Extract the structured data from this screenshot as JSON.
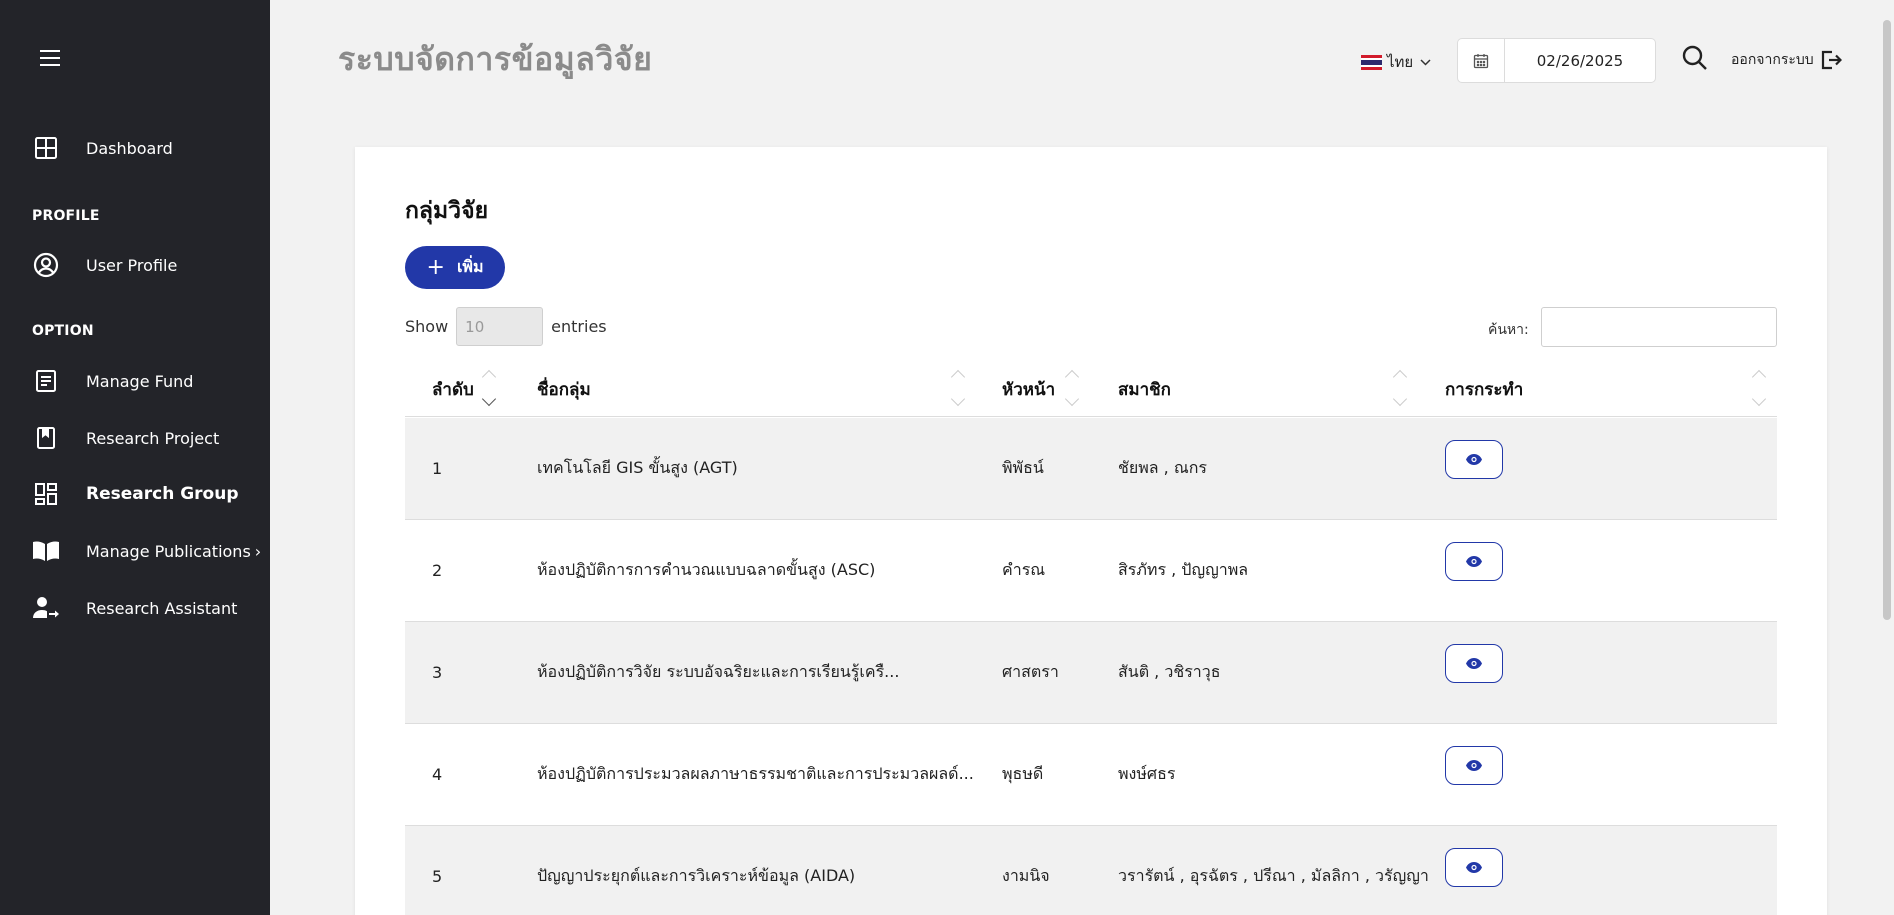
{
  "sidebar": {
    "dashboard": "Dashboard",
    "profile_section": "PROFILE",
    "user_profile": "User Profile",
    "option_section": "OPTION",
    "manage_fund": "Manage Fund",
    "research_project": "Research Project",
    "research_group": "Research Group",
    "manage_publications": "Manage Publications",
    "manage_publications_chevron": "›",
    "research_assistant": "Research Assistant"
  },
  "header": {
    "app_title": "ระบบจัดการข้อมูลวิจัย",
    "language": "ไทย",
    "date": "02/26/2025",
    "logout": "ออกจากระบบ"
  },
  "card": {
    "title": "กลุ่มวิจัย",
    "add_button": "เพิ่ม",
    "add_plus": "+",
    "show_label": "Show",
    "entries_value": "10",
    "entries_label": "entries",
    "search_label": "ค้นหา:",
    "search_value": ""
  },
  "table": {
    "columns": [
      "ลำดับ",
      "ชื่อกลุ่ม",
      "หัวหน้า",
      "สมาชิก",
      "การกระทำ"
    ],
    "rows": [
      {
        "no": "1",
        "name": "เทคโนโลยี GIS ขั้นสูง (AGT)",
        "head": "พิพัธน์",
        "members": "ชัยพล , ณกร"
      },
      {
        "no": "2",
        "name": "ห้องปฏิบัติการการคำนวณแบบฉลาดขั้นสูง (ASC)",
        "head": "คำรณ",
        "members": "สิรภัทร , ปัญญาพล"
      },
      {
        "no": "3",
        "name": "ห้องปฏิบัติการวิจัย ระบบอัจฉริยะและการเรียนรู้เครื...",
        "head": "ศาสตรา",
        "members": "สันติ , วชิราวุธ"
      },
      {
        "no": "4",
        "name": "ห้องปฏิบัติการประมวลผลภาษาธรรมชาติและการประมวลผลด์...",
        "head": "พุธษดี",
        "members": "พงษ์ศธร"
      },
      {
        "no": "5",
        "name": "ปัญญาประยุกต์และการวิเคราะห์ข้อมูล (AIDA)",
        "head": "งามนิจ",
        "members": "วรารัตน์ , อุรฉัตร , ปรีณา , มัลลิกา , วรัญญา"
      }
    ]
  },
  "colors": {
    "sidebar_bg": "#232429",
    "accent": "#2238a8",
    "page_bg": "#f2f2f2"
  },
  "icons": [
    "menu-icon",
    "dashboard-icon",
    "user-circle-icon",
    "document-icon",
    "bookmark-icon",
    "grid-icon",
    "book-icon",
    "user-arrow-icon",
    "thai-flag-icon",
    "calendar-icon",
    "search-icon",
    "logout-icon",
    "eye-icon"
  ]
}
